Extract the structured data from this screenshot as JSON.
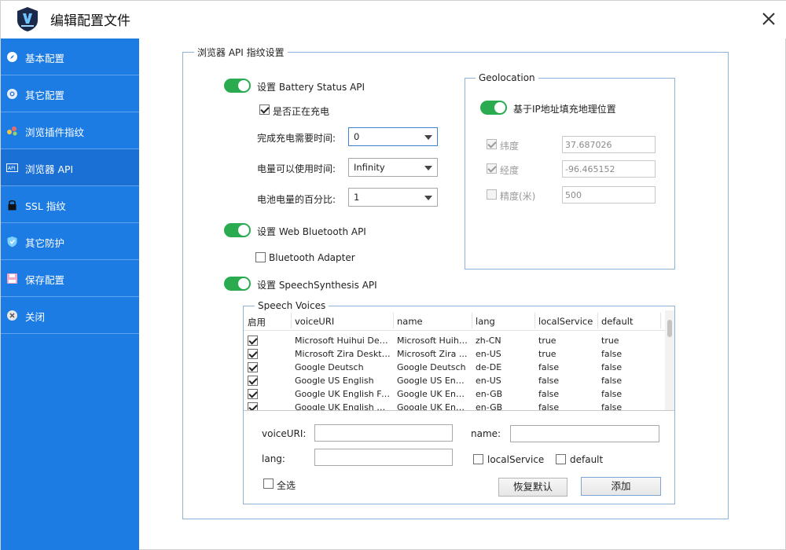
{
  "window": {
    "title": "编辑配置文件"
  },
  "sidebar": {
    "items": [
      {
        "label": "基本配置"
      },
      {
        "label": "其它配置"
      },
      {
        "label": "浏览插件指纹"
      },
      {
        "label": "浏览器 API"
      },
      {
        "label": "SSL 指纹"
      },
      {
        "label": "其它防护"
      },
      {
        "label": "保存配置"
      },
      {
        "label": "关闭"
      }
    ]
  },
  "main": {
    "group_title": "浏览器 API 指纹设置",
    "battery": {
      "toggle_label": "设置 Battery Status API",
      "charging_label": "是否正在充电",
      "charge_time_label": "完成充电需要时间:",
      "charge_time_value": "0",
      "discharge_time_label": "电量可以使用时间:",
      "discharge_time_value": "Infinity",
      "level_label": "电池电量的百分比:",
      "level_value": "1"
    },
    "bluetooth": {
      "toggle_label": "设置 Web Bluetooth API",
      "adapter_label": "Bluetooth Adapter"
    },
    "speech": {
      "toggle_label": "设置 SpeechSynthesis API",
      "voices_title": "Speech Voices",
      "columns": [
        "启用",
        "voiceURI",
        "name",
        "lang",
        "localService",
        "default"
      ],
      "rows": [
        {
          "voiceURI": "Microsoft Huihui Desk...",
          "name": "Microsoft Huihu...",
          "lang": "zh-CN",
          "localService": "true",
          "default": "true"
        },
        {
          "voiceURI": "Microsoft Zira Deskto...",
          "name": "Microsoft Zira ...",
          "lang": "en-US",
          "localService": "true",
          "default": "false"
        },
        {
          "voiceURI": "Google Deutsch",
          "name": "Google Deutsch",
          "lang": "de-DE",
          "localService": "false",
          "default": "false"
        },
        {
          "voiceURI": "Google US English",
          "name": "Google US English",
          "lang": "en-US",
          "localService": "false",
          "default": "false"
        },
        {
          "voiceURI": "Google UK English Fe...",
          "name": "Google UK Engli...",
          "lang": "en-GB",
          "localService": "false",
          "default": "false"
        },
        {
          "voiceURI": "Google UK English Male",
          "name": "Google UK Engli...",
          "lang": "en-GB",
          "localService": "false",
          "default": "false"
        }
      ],
      "form": {
        "voiceURI_label": "voiceURI:",
        "name_label": "name:",
        "lang_label": "lang:",
        "local_service_label": "localService",
        "default_label": "default",
        "select_all_label": "全选",
        "restore_button": "恢复默认",
        "add_button": "添加"
      }
    },
    "geolocation": {
      "title": "Geolocation",
      "toggle_label": "基于IP地址填充地理位置",
      "latitude_label": "纬度",
      "latitude_value": "37.687026",
      "longitude_label": "经度",
      "longitude_value": "-96.465152",
      "accuracy_label": "精度(米)",
      "accuracy_value": "500"
    }
  },
  "colors": {
    "sidebar": "#1d7ce3",
    "toggle_on": "#2bab4f",
    "border": "#8db3da"
  }
}
